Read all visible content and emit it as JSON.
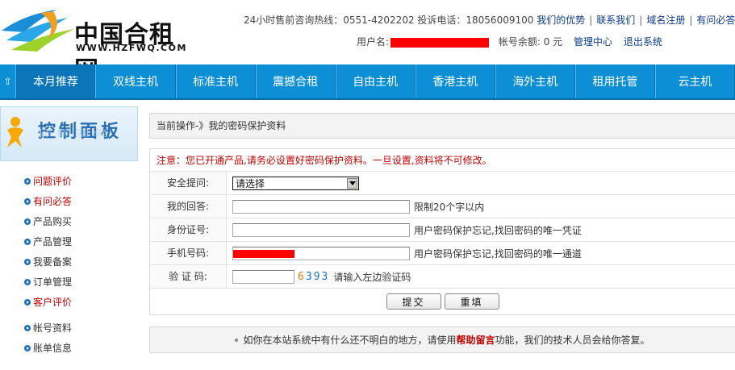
{
  "header": {
    "logo_cn": "中国合租网",
    "logo_url": "WWW.HZFWQ.COM",
    "hotline_text": "24小时售前咨询热线：0551-4202202 投诉电话：18056009100",
    "links": [
      "我们的优势",
      "联系我们",
      "域名注册",
      "有问必答",
      "代"
    ],
    "username_label": "用户名:",
    "balance_text": "帐号余额: 0 元",
    "admin_link": "管理中心",
    "logout_link": "退出系统"
  },
  "nav": {
    "items": [
      "本月推荐",
      "双线主机",
      "标准主机",
      "震撼合租",
      "自由主机",
      "香港主机",
      "海外主机",
      "租用托管",
      "云主机"
    ],
    "active_index": 0
  },
  "sidebar": {
    "panel_title": "控制面板",
    "group1": [
      {
        "label": "问题评价",
        "red": true
      },
      {
        "label": "有问必答",
        "red": true
      },
      {
        "label": "产品购买",
        "red": false
      },
      {
        "label": "产品管理",
        "red": false
      },
      {
        "label": "我要备案",
        "red": false
      },
      {
        "label": "订单管理",
        "red": false
      },
      {
        "label": "客户评价",
        "red": true
      }
    ],
    "group2": [
      {
        "label": "帐号资料",
        "red": false
      },
      {
        "label": "账单信息",
        "red": false
      }
    ]
  },
  "main": {
    "breadcrumb": "当前操作-》我的密码保护资料",
    "notice": "注意：您已开通产品,请务必设置好密码保护资料。一旦设置,资料将不可修改。",
    "fields": {
      "question": {
        "label": "安全提问:",
        "selected": "请选择"
      },
      "answer": {
        "label": "我的回答:",
        "value": "",
        "hint": "限制20个字以内"
      },
      "idcard": {
        "label": "身份证号:",
        "value": "",
        "hint": "用户密码保护忘记,找回密码的唯一凭证"
      },
      "phone": {
        "label": "手机号码:",
        "hint": "用户密码保护忘记,找回密码的唯一通道"
      },
      "captcha": {
        "label": "验 证 码:",
        "value": "",
        "code": [
          "6",
          "3",
          "9",
          "3"
        ],
        "hint": "请输入左边验证码"
      }
    },
    "submit_label": "提交",
    "reset_label": "重填",
    "help": {
      "prefix": "如你在本站系统中有什么还不明白的地方，请使用",
      "link": "帮助留言",
      "suffix": "功能，我们的技术人员会给你答复。"
    }
  },
  "colors": {
    "nav_bg": "#0d8fd6",
    "nav_active": "#0a75b9",
    "notice_red": "#c00000",
    "link_blue": "#0a3a8a",
    "redaction": "#ff0000"
  }
}
